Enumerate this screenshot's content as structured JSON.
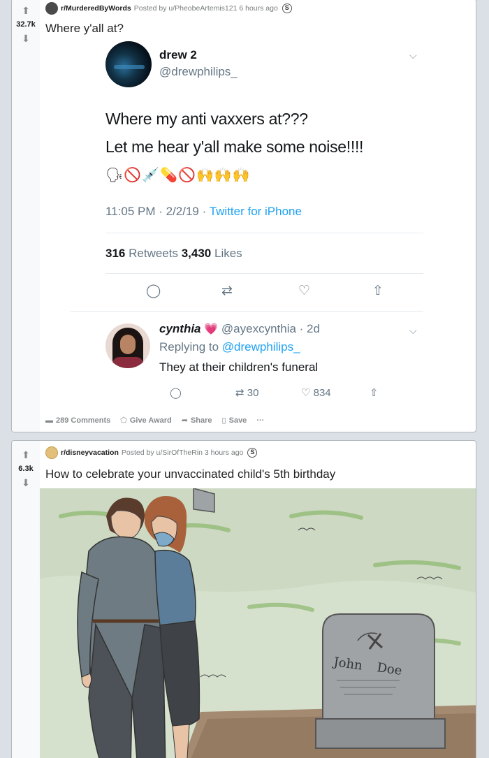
{
  "post1": {
    "subreddit": "r/MurderedByWords",
    "posted_by": "Posted by u/PheobeArtemis121 6 hours ago",
    "votes": "32.7k",
    "title": "Where y'all at?",
    "tweet": {
      "name": "drew 2",
      "handle": "@drewphilips_",
      "text_line1": "Where my anti vaxxers at???",
      "text_line2": "Let me hear y'all make some noise!!!!",
      "emojis": "🗣🚫💉💊🚫🙌🙌🙌",
      "time": "11:05 PM · 2/2/19 · ",
      "source": "Twitter for iPhone",
      "retweets_count": "316",
      "retweets_label": "Retweets",
      "likes_count": "3,430",
      "likes_label": "Likes",
      "reply": {
        "name": "cynthia",
        "heart": "💗",
        "handle_time": "@ayexcynthia · 2d",
        "replying_prefix": "Replying to ",
        "replying_to": "@drewphilips_",
        "text": "They at their children's funeral",
        "retweets": "30",
        "likes": "834"
      }
    },
    "footer": {
      "comments": "289 Comments",
      "award": "Give Award",
      "share": "Share",
      "save": "Save",
      "more": "···"
    }
  },
  "post2": {
    "subreddit": "r/disneyvacation",
    "posted_by": "Posted by u/SirOfTheRin 3 hours ago",
    "votes": "6.3k",
    "title": "How to celebrate your unvaccinated child's 5th birthday",
    "gravestone_line1": "John",
    "gravestone_line2": "Doe"
  },
  "icons": {
    "upvote": "upvote-arrow-icon",
    "downvote": "downvote-arrow-icon",
    "reply": "reply-bubble-icon",
    "retweet": "retweet-icon",
    "like": "heart-icon",
    "share": "share-upload-icon",
    "chevron": "chevron-down-icon"
  },
  "colors": {
    "twitter_blue": "#1da1f2",
    "reddit_bg": "#dae0e6",
    "muted": "#657786"
  }
}
